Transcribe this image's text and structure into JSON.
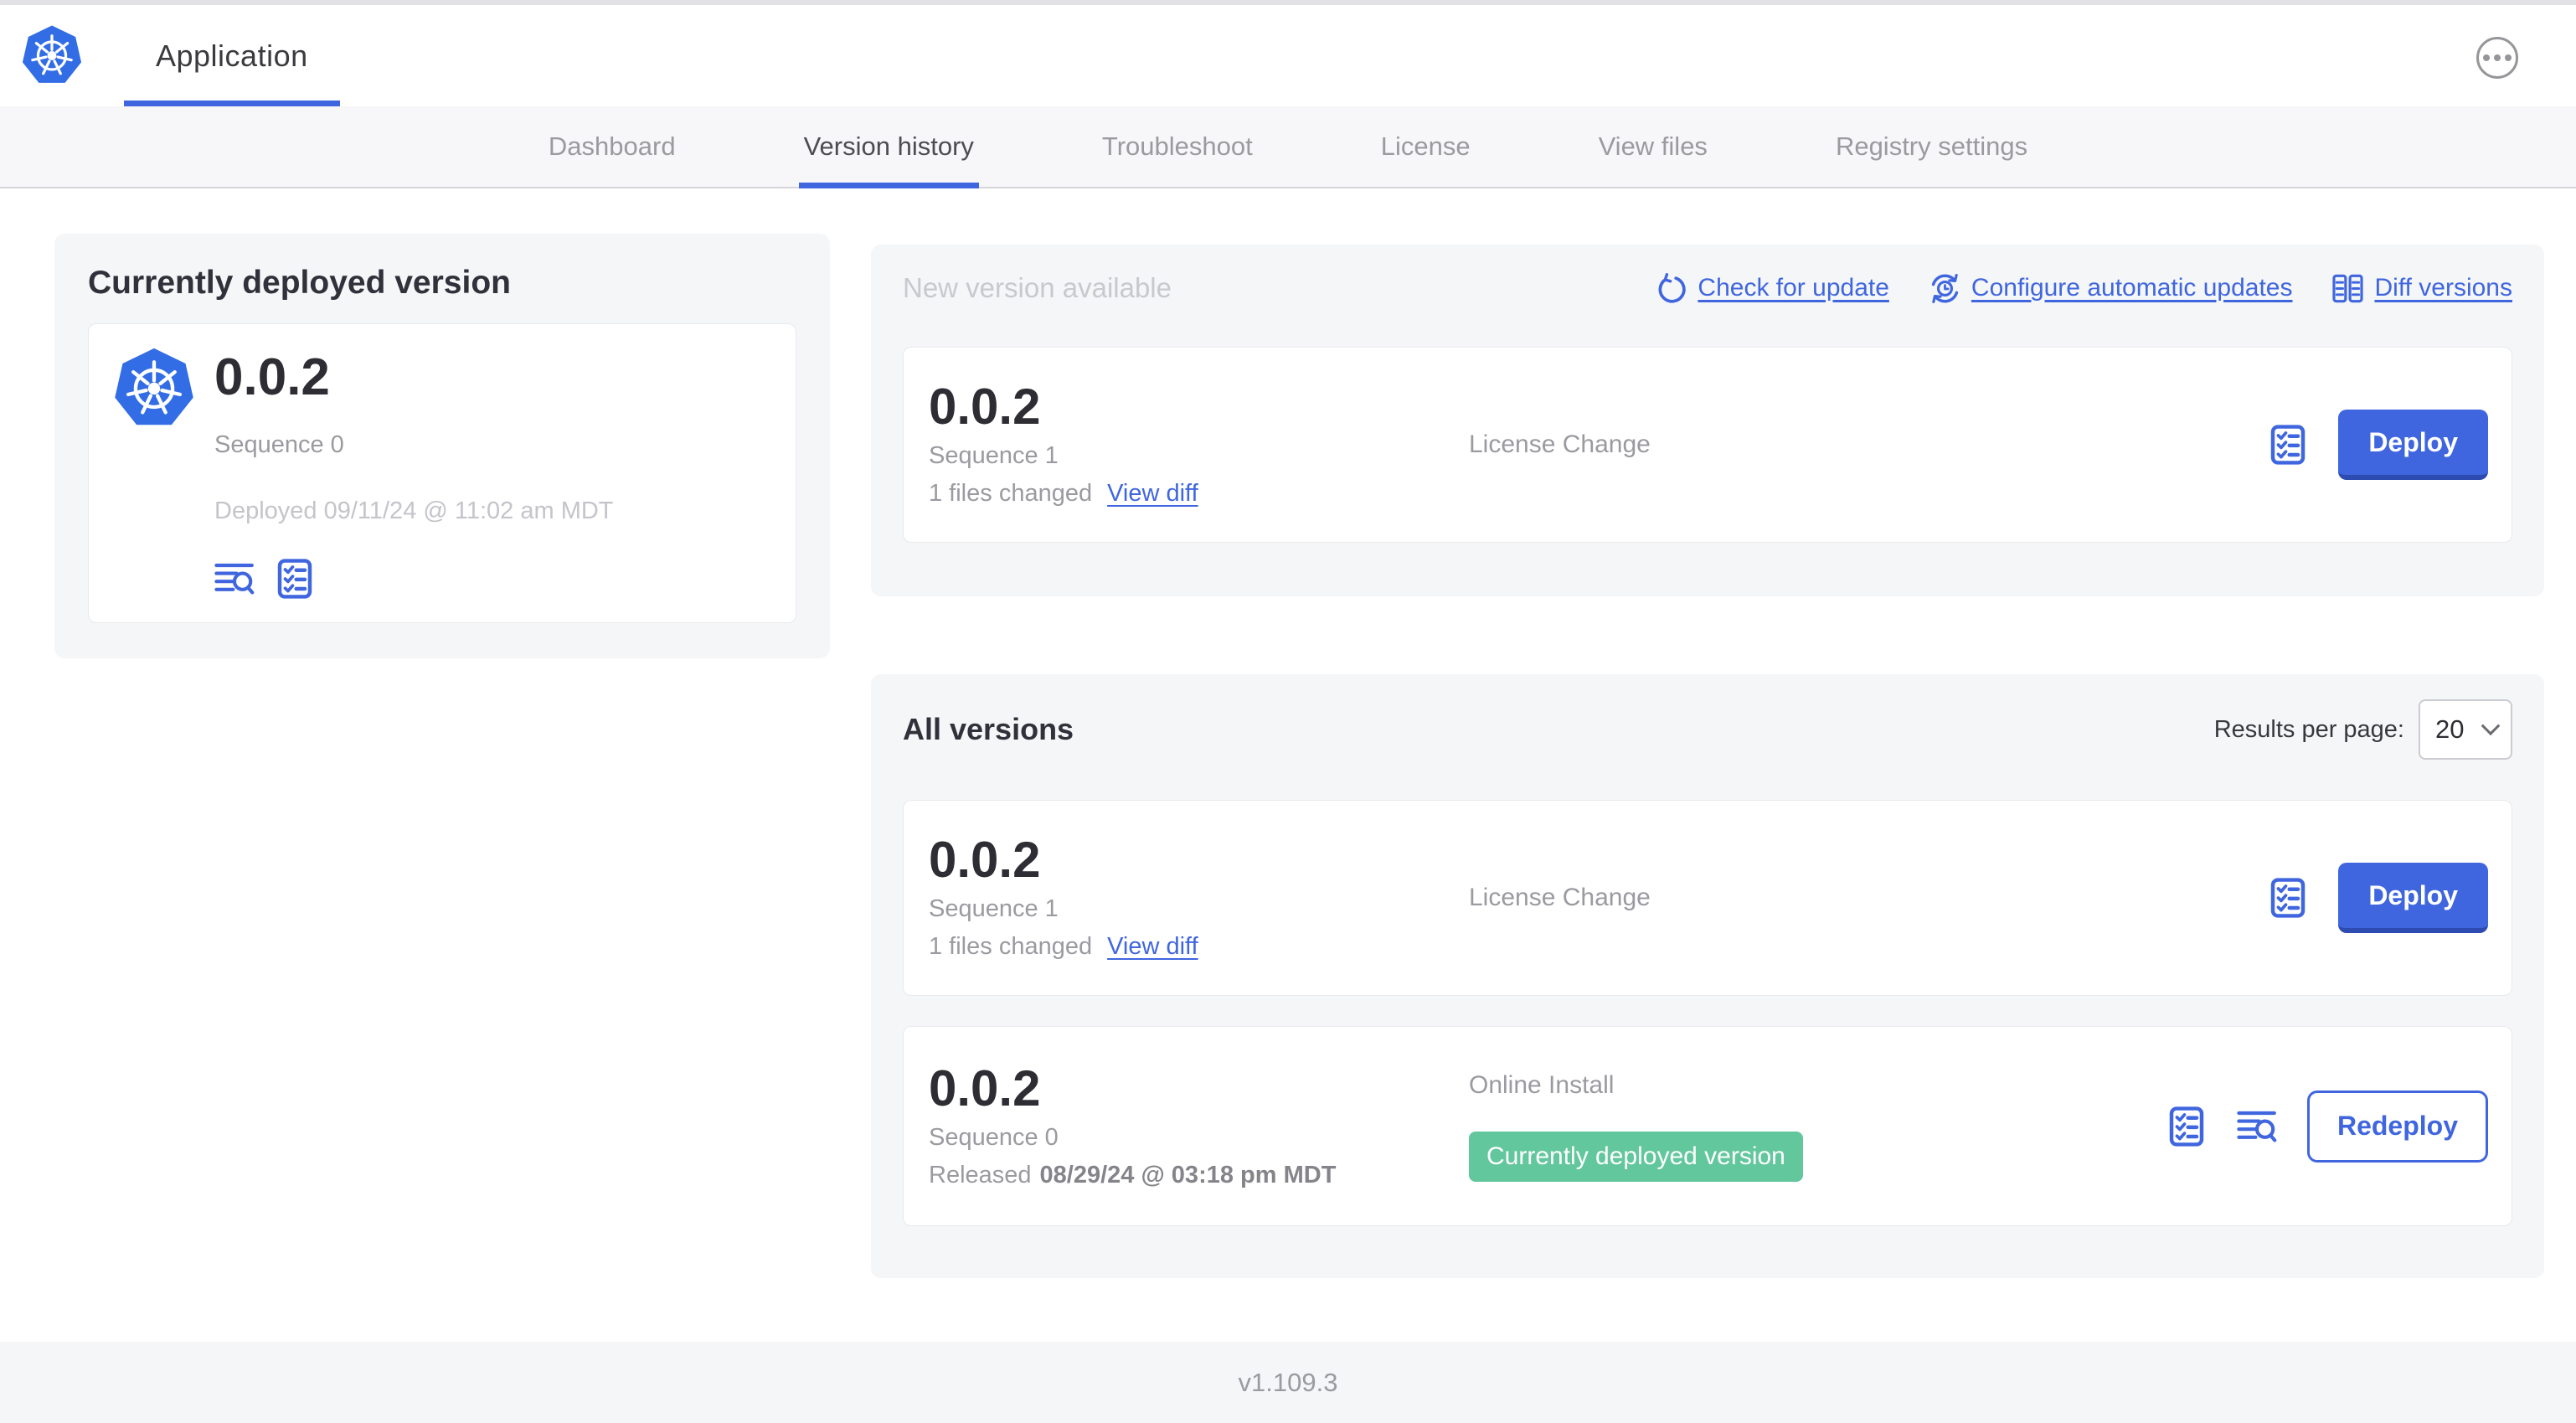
{
  "header": {
    "app_title": "Application",
    "logo_icon": "kubernetes-logo",
    "menu_icon": "ellipsis-icon"
  },
  "tabs": {
    "items": [
      {
        "label": "Dashboard",
        "active": false
      },
      {
        "label": "Version history",
        "active": true
      },
      {
        "label": "Troubleshoot",
        "active": false
      },
      {
        "label": "License",
        "active": false
      },
      {
        "label": "View files",
        "active": false
      },
      {
        "label": "Registry settings",
        "active": false
      }
    ]
  },
  "current_version_panel": {
    "title": "Currently deployed version",
    "version": "0.0.2",
    "sequence": "Sequence 0",
    "deployed": "Deployed 09/11/24 @ 11:02 am MDT",
    "icons": [
      "logs-icon",
      "checklist-icon"
    ]
  },
  "new_version_panel": {
    "title": "New version available",
    "links": [
      {
        "label": "Check for update",
        "icon": "refresh-icon"
      },
      {
        "label": "Configure automatic updates",
        "icon": "schedule-update-icon"
      },
      {
        "label": "Diff versions",
        "icon": "diff-icon"
      }
    ],
    "card": {
      "version": "0.0.2",
      "sequence": "Sequence 1",
      "files_changed": "1 files changed",
      "view_diff_label": "View diff",
      "source": "License Change",
      "action_label": "Deploy"
    }
  },
  "all_versions_panel": {
    "title": "All versions",
    "results_per_page_label": "Results per page:",
    "results_per_page_value": "20",
    "cards": [
      {
        "version": "0.0.2",
        "sequence": "Sequence 1",
        "files_changed": "1 files changed",
        "view_diff_label": "View diff",
        "source": "License Change",
        "action_label": "Deploy"
      },
      {
        "version": "0.0.2",
        "sequence": "Sequence 0",
        "released_prefix": "Released",
        "released_date": "08/29/24 @ 03:18 pm MDT",
        "source": "Online Install",
        "badge": "Currently deployed version",
        "action_label": "Redeploy"
      }
    ]
  },
  "footer": {
    "version": "v1.109.3"
  },
  "colors": {
    "primary_blue": "#4066df",
    "badge_green": "#63c79d",
    "panel_gray": "#f5f6f8"
  }
}
